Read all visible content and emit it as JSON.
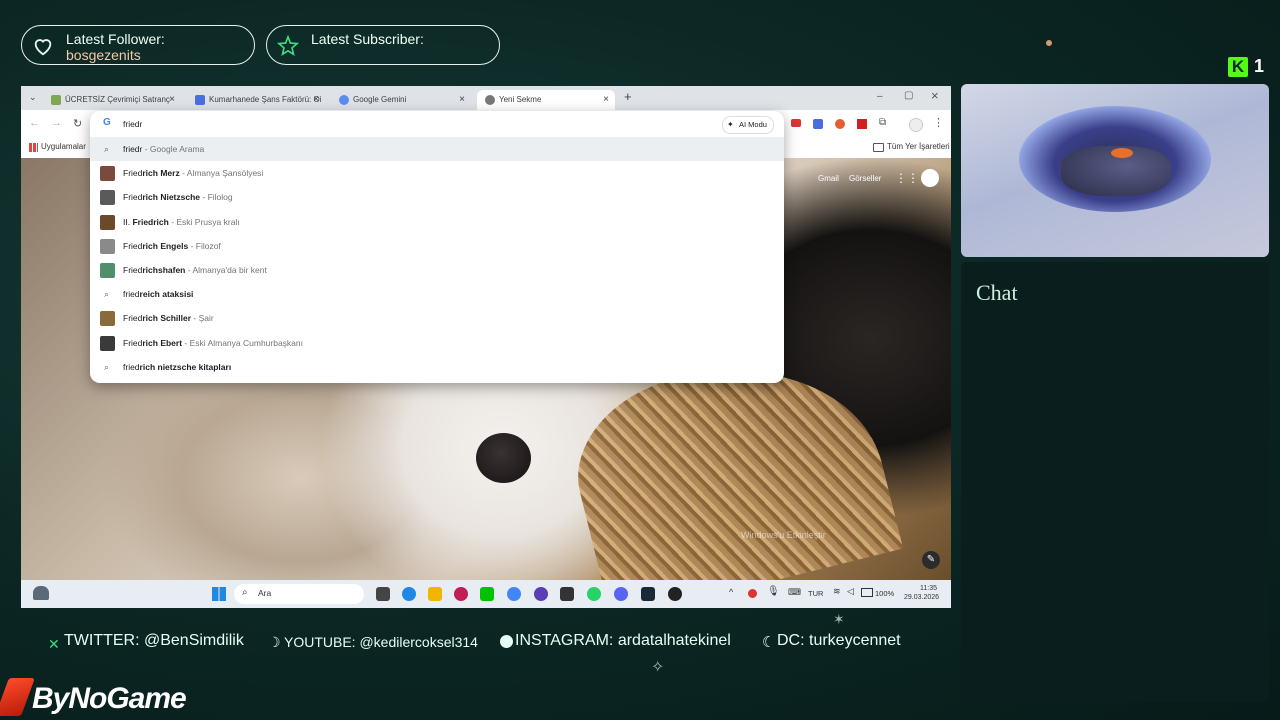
{
  "alerts": {
    "follower": {
      "label": "Latest Follower:",
      "name": "bosgezenits"
    },
    "subscriber": {
      "label": "Latest Subscriber:",
      "name": ""
    }
  },
  "kick": {
    "logo": "K",
    "count": "1"
  },
  "browser": {
    "tabs": [
      {
        "title": "ÜCRETSİZ Çevrimiçi Satranç",
        "close": "×",
        "icon": "chess-icon",
        "color": "#7fa650"
      },
      {
        "title": "Kumarhanede Şans Faktörü: Oi",
        "close": "×",
        "icon": "doc-icon",
        "color": "#4a6ee0"
      },
      {
        "title": "Google Gemini",
        "close": "×",
        "icon": "gemini-icon",
        "color": "#5b8def"
      },
      {
        "title": "Yeni Sekme",
        "close": "×",
        "icon": "chrome-icon",
        "color": "#777777"
      }
    ],
    "new_tab": "+",
    "window": {
      "min": "–",
      "max": "▢",
      "close": "×"
    },
    "omnibox_value": "friedr",
    "ai_mode": "AI Modu",
    "bookmarks_apps": "Uygulamalar",
    "all_bookmarks": "Tüm Yer İşaretleri",
    "newtab_links": {
      "gmail": "Gmail",
      "images": "Görseller"
    },
    "suggestions": [
      {
        "typed": "friedr",
        "rest": "",
        "desc": " - Google Arama",
        "kind": "search",
        "thumb": ""
      },
      {
        "typed": "Fried",
        "rest": "rich Merz",
        "desc": " - Almanya Şansölyesi",
        "kind": "entity",
        "thumb": "#7a4a3c"
      },
      {
        "typed": "Fried",
        "rest": "rich Nietzsche",
        "desc": " - Filolog",
        "kind": "entity",
        "thumb": "#5a5a5a"
      },
      {
        "typed": "II. ",
        "rest": "Friedrich",
        "desc": " - Eski Prusya kralı",
        "kind": "entity",
        "thumb": "#6b4a2a"
      },
      {
        "typed": "Fried",
        "rest": "rich Engels",
        "desc": " - Filozof",
        "kind": "entity",
        "thumb": "#8a8a8a"
      },
      {
        "typed": "Fried",
        "rest": "richshafen",
        "desc": " - Almanya'da bir kent",
        "kind": "entity",
        "thumb": "#4f8f6a"
      },
      {
        "typed": "fried",
        "rest": "reich ataksisi",
        "desc": "",
        "kind": "search",
        "thumb": ""
      },
      {
        "typed": "Fried",
        "rest": "rich Schiller",
        "desc": " - Şair",
        "kind": "entity",
        "thumb": "#8a6a3a"
      },
      {
        "typed": "Fried",
        "rest": "rich Ebert",
        "desc": " - Eski Almanya Cumhurbaşkanı",
        "kind": "entity",
        "thumb": "#3a3a3a"
      },
      {
        "typed": "fried",
        "rest": "rich nietzsche kitapları",
        "desc": "",
        "kind": "search",
        "thumb": ""
      }
    ],
    "watermark": "Windows'u Etkinleştir"
  },
  "taskbar": {
    "search": "Ara",
    "lang": "TUR",
    "battery": "100%",
    "time": "11:35",
    "date": "29.03.2026"
  },
  "chat": {
    "title": "Chat"
  },
  "socials": [
    {
      "text": "TWITTER: @BenSimdilik"
    },
    {
      "text": "YOUTUBE: @kedilercoksel314"
    },
    {
      "text": "INSTAGRAM: ardatalhatekinel"
    },
    {
      "text": "DC: turkeycennet"
    }
  ],
  "sponsor": {
    "name": "ByNoGame"
  },
  "colors": {
    "accent": "#3ddc84",
    "follower_name": "#f4c9a8",
    "bg": "#0b2623"
  }
}
